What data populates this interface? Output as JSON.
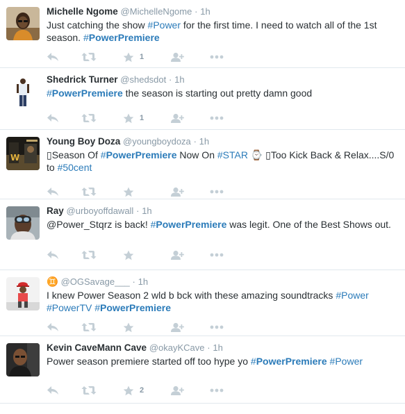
{
  "tweets": [
    {
      "fullname": "Michelle Ngome",
      "username": "@MichelleNgome",
      "dot": "·",
      "time": "1h",
      "avatar": "avatar-woman-glasses",
      "segments": [
        {
          "t": "Just catching the show ",
          "k": "plain"
        },
        {
          "t": "#Power",
          "k": "hash"
        },
        {
          "t": " for the first time. I need to watch all of the 1st season. ",
          "k": "plain"
        },
        {
          "t": "#",
          "k": "hash"
        },
        {
          "t": "PowerPremiere",
          "k": "hashbold"
        }
      ],
      "favorites": "1"
    },
    {
      "fullname": "Shedrick Turner",
      "username": "@shedsdot",
      "dot": "·",
      "time": "1h",
      "avatar": "avatar-man-standing",
      "segments": [
        {
          "t": "#",
          "k": "hash"
        },
        {
          "t": "PowerPremiere",
          "k": "hashbold"
        },
        {
          "t": " the season is starting out pretty damn good",
          "k": "plain"
        }
      ],
      "favorites": "1"
    },
    {
      "fullname": "Young Boy Doza",
      "username": "@youngboydoza",
      "dot": "·",
      "time": "1h",
      "avatar": "avatar-poster",
      "segments": [
        {
          "t": "▯",
          "k": "plain"
        },
        {
          "t": "Season Of ",
          "k": "plain"
        },
        {
          "t": "#",
          "k": "hash"
        },
        {
          "t": "PowerPremiere",
          "k": "hashbold"
        },
        {
          "t": " Now On ",
          "k": "plain"
        },
        {
          "t": "#STAR",
          "k": "hash"
        },
        {
          "t": " ⌚ ▯",
          "k": "plain"
        },
        {
          "t": "Too Kick Back & Relax....S/0 to ",
          "k": "plain"
        },
        {
          "t": "#50cent",
          "k": "hash"
        }
      ],
      "favorites": ""
    },
    {
      "fullname": "Ray",
      "username": "@urboyoffdawall",
      "dot": "·",
      "time": "1h",
      "avatar": "avatar-goggles",
      "segments": [
        {
          "t": "@Power_Stqrz is back! ",
          "k": "plain"
        },
        {
          "t": "#",
          "k": "hash"
        },
        {
          "t": "PowerPremiere",
          "k": "hashbold"
        },
        {
          "t": " was legit. One of the Best Shows out.",
          "k": "plain"
        }
      ],
      "favorites": ""
    },
    {
      "fullname": "♊",
      "username": "@OGSavage___",
      "dot": "·",
      "time": "1h",
      "avatar": "avatar-red-cap",
      "segments": [
        {
          "t": "I knew Power Season 2 wld b bck with these amazing soundtracks ",
          "k": "plain"
        },
        {
          "t": "#Power",
          "k": "hash"
        },
        {
          "t": " ",
          "k": "plain"
        },
        {
          "t": "#PowerTV",
          "k": "hash"
        },
        {
          "t": " ",
          "k": "plain"
        },
        {
          "t": "#",
          "k": "hash"
        },
        {
          "t": "PowerPremiere",
          "k": "hashbold"
        }
      ],
      "favorites": ""
    },
    {
      "fullname": "Kevin CaveMann Cave",
      "username": "@okayKCave",
      "dot": "·",
      "time": "1h",
      "avatar": "avatar-bald-man",
      "segments": [
        {
          "t": "Power season premiere started off too hype yo ",
          "k": "plain"
        },
        {
          "t": "#",
          "k": "hash"
        },
        {
          "t": "PowerPremiere",
          "k": "hashbold"
        },
        {
          "t": " ",
          "k": "plain"
        },
        {
          "t": "#Power",
          "k": "hash"
        }
      ],
      "favorites": "2"
    }
  ],
  "action_icons": [
    "reply-icon",
    "retweet-icon",
    "favorite-icon",
    "follow-icon",
    "more-icon"
  ],
  "colors": {
    "hashtag": "#2b7bb9",
    "meta": "#8899a6",
    "icon": "#c4cfd6",
    "divider": "#e1e8ed"
  }
}
